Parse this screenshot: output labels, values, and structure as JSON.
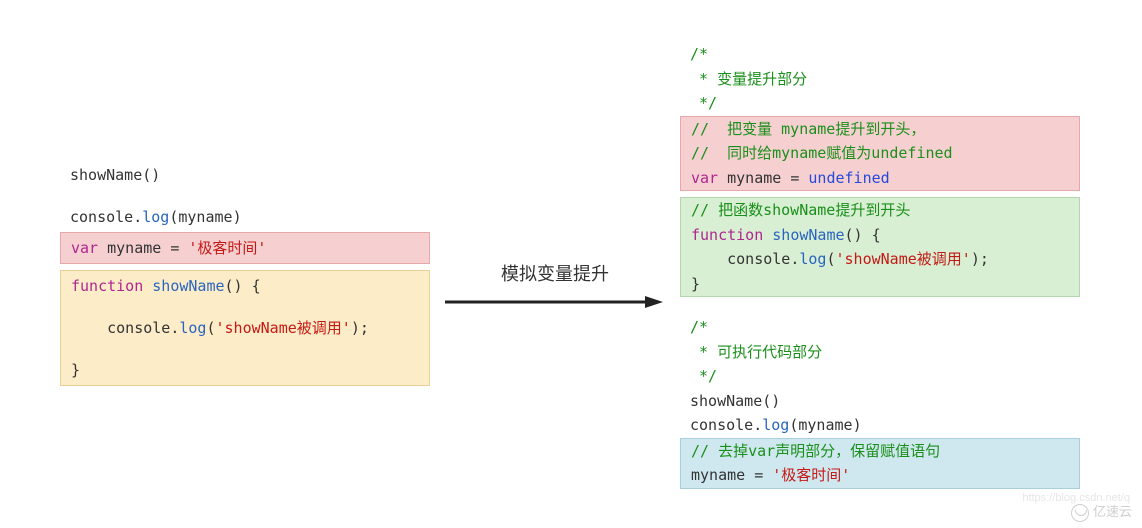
{
  "left": {
    "line1": "showName()",
    "line2_pre": "console",
    "line2_dot": ".",
    "line2_fn": "log",
    "line2_open": "(",
    "line2_arg": "myname",
    "line2_close": ")",
    "pink_kw": "var",
    "pink_ident": " myname ",
    "pink_eq": "=",
    "pink_str": " '极客时间'",
    "yellow_l1_kw": "function",
    "yellow_l1_fn": " showName",
    "yellow_l1_rest": "() {",
    "yellow_l2_indent": "    ",
    "yellow_l2_obj": "console",
    "yellow_l2_dot": ".",
    "yellow_l2_fn": "log",
    "yellow_l2_open": "(",
    "yellow_l2_str": "'showName被调用'",
    "yellow_l2_close": ");",
    "yellow_l3": "}"
  },
  "arrow": {
    "label": "模拟变量提升"
  },
  "right": {
    "c1_l1": "/*",
    "c1_l2": " * 变量提升部分",
    "c1_l3": " */",
    "pink_c1": "//  把变量 myname提升到开头，",
    "pink_c2": "//  同时给myname赋值为undefined",
    "pink_kw": "var",
    "pink_ident": " myname ",
    "pink_eq": "=",
    "pink_undef": " undefined",
    "green_c1": "// 把函数showName提升到开头",
    "green_l1_kw": "function",
    "green_l1_fn": " showName",
    "green_l1_rest": "() {",
    "green_l2_indent": "    ",
    "green_l2_obj": "console",
    "green_l2_dot": ".",
    "green_l2_fn": "log",
    "green_l2_open": "(",
    "green_l2_str": "'showName被调用'",
    "green_l2_close": ");",
    "green_l3": "}",
    "c2_l1": "/*",
    "c2_l2": " * 可执行代码部分",
    "c2_l3": " */",
    "exec_l1": "showName()",
    "exec_l2_obj": "console",
    "exec_l2_dot": ".",
    "exec_l2_fn": "log",
    "exec_l2_open": "(",
    "exec_l2_arg": "myname",
    "exec_l2_close": ")",
    "blue_c1": "// 去掉var声明部分，保留赋值语句",
    "blue_ident": "myname ",
    "blue_eq": "=",
    "blue_str": " '极客时间'"
  },
  "watermark": {
    "text": "亿速云",
    "url": "https://blog.csdn.net/q"
  }
}
